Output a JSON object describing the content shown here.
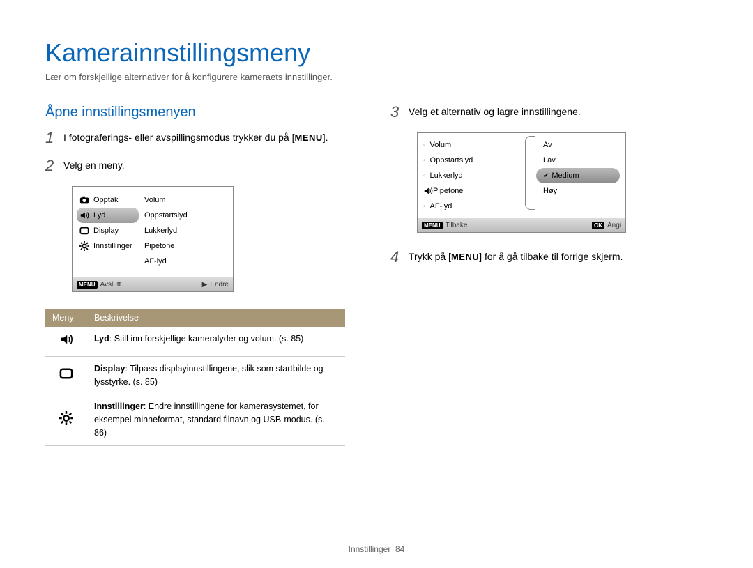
{
  "title": "Kamerainnstillingsmeny",
  "intro": "Lær om forskjellige alternativer for å konfigurere kameraets innstillinger.",
  "section_heading": "Åpne innstillingsmenyen",
  "steps": {
    "s1_prefix": "I fotograferings- eller avspillingsmodus trykker du på ",
    "s1_button": "MENU",
    "s1_suffix": ".",
    "s2": "Velg en meny.",
    "s3": "Velg et alternativ og lagre innstillingene.",
    "s4_prefix": "Trykk på ",
    "s4_button": "MENU",
    "s4_suffix": " for å gå tilbake til forrige skjerm."
  },
  "step_numbers": {
    "n1": "1",
    "n2": "2",
    "n3": "3",
    "n4": "4"
  },
  "screen1": {
    "left": [
      {
        "icon": "camera",
        "label": "Opptak"
      },
      {
        "icon": "sound",
        "label": "Lyd",
        "selected": true
      },
      {
        "icon": "display",
        "label": "Display"
      },
      {
        "icon": "gear",
        "label": "Innstillinger"
      }
    ],
    "right": [
      "Volum",
      "Oppstartslyd",
      "Lukkerlyd",
      "Pipetone",
      "AF-lyd"
    ],
    "footer_left_badge": "MENU",
    "footer_left": "Avslutt",
    "footer_right_icon": "▶",
    "footer_right": "Endre"
  },
  "screen2": {
    "left": [
      {
        "label": "Volum"
      },
      {
        "label": "Oppstartslyd"
      },
      {
        "label": "Lukkerlyd"
      },
      {
        "label": "Pipetone",
        "icon": "sound"
      },
      {
        "label": "AF-lyd"
      }
    ],
    "right": [
      {
        "label": "Av"
      },
      {
        "label": "Lav"
      },
      {
        "label": "Medium",
        "selected": true,
        "check": true
      },
      {
        "label": "Høy"
      }
    ],
    "footer_left_badge": "MENU",
    "footer_left": "Tilbake",
    "footer_right_badge": "OK",
    "footer_right": "Angi"
  },
  "table": {
    "head_menu": "Meny",
    "head_desc": "Beskrivelse",
    "rows": [
      {
        "icon": "sound",
        "bold": "Lyd",
        "text": ": Still inn forskjellige kameralyder og volum. (s. 85)"
      },
      {
        "icon": "display",
        "bold": "Display",
        "text": ": Tilpass displayinnstillingene, slik som startbilde og lysstyrke. (s. 85)"
      },
      {
        "icon": "gear",
        "bold": "Innstillinger",
        "text": ": Endre innstillingene for kamerasystemet, for eksempel minneformat, standard filnavn og USB-modus. (s. 86)"
      }
    ]
  },
  "footer": {
    "section": "Innstillinger",
    "page": "84"
  }
}
